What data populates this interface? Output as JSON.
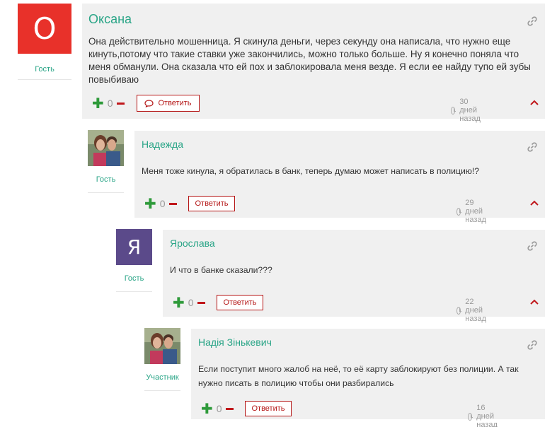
{
  "comments": [
    {
      "author": "Оксана",
      "avatar_letter": "О",
      "avatar_color": "#e8312a",
      "role": "Гость",
      "text": "Она действительно мошенница. Я скинула деньги, через секунду она написала, что нужно еще кинуть,потому что такие ставки уже закончились, можно только больше. Ну я конечно поняла что меня обманули. Она сказала что ей пох и заблокировала меня везде. Я если ее найду тупо ей зубы повыбиваю",
      "votes": "0",
      "reply_label": "Ответить",
      "time": "30 дней назад"
    },
    {
      "author": "Надежда",
      "avatar_letter": "",
      "role": "Гость",
      "text": "Меня тоже кинула, я обратилась в банк, теперь думаю может написать в полицию!?",
      "votes": "0",
      "reply_label": "Ответить",
      "time": "29 дней назад"
    },
    {
      "author": "Ярослава",
      "avatar_letter": "Я",
      "avatar_color": "#5b4a8a",
      "role": "Гость",
      "text": "И что в банке сказали???",
      "votes": "0",
      "reply_label": "Ответить",
      "time": "22 дней назад"
    },
    {
      "author": "Надія Зінькевич",
      "avatar_letter": "",
      "role": "Участник",
      "text": "Если поступит много жалоб на неё, то её карту заблокируют без полиции. А так нужно писать в полицию чтобы они разбирались",
      "votes": "0",
      "reply_label": "Ответить",
      "time": "16 дней назад"
    }
  ],
  "colors": {
    "accent_green": "#2aa587",
    "reply_red": "#b41414",
    "plus_green": "#2e9a3a"
  }
}
